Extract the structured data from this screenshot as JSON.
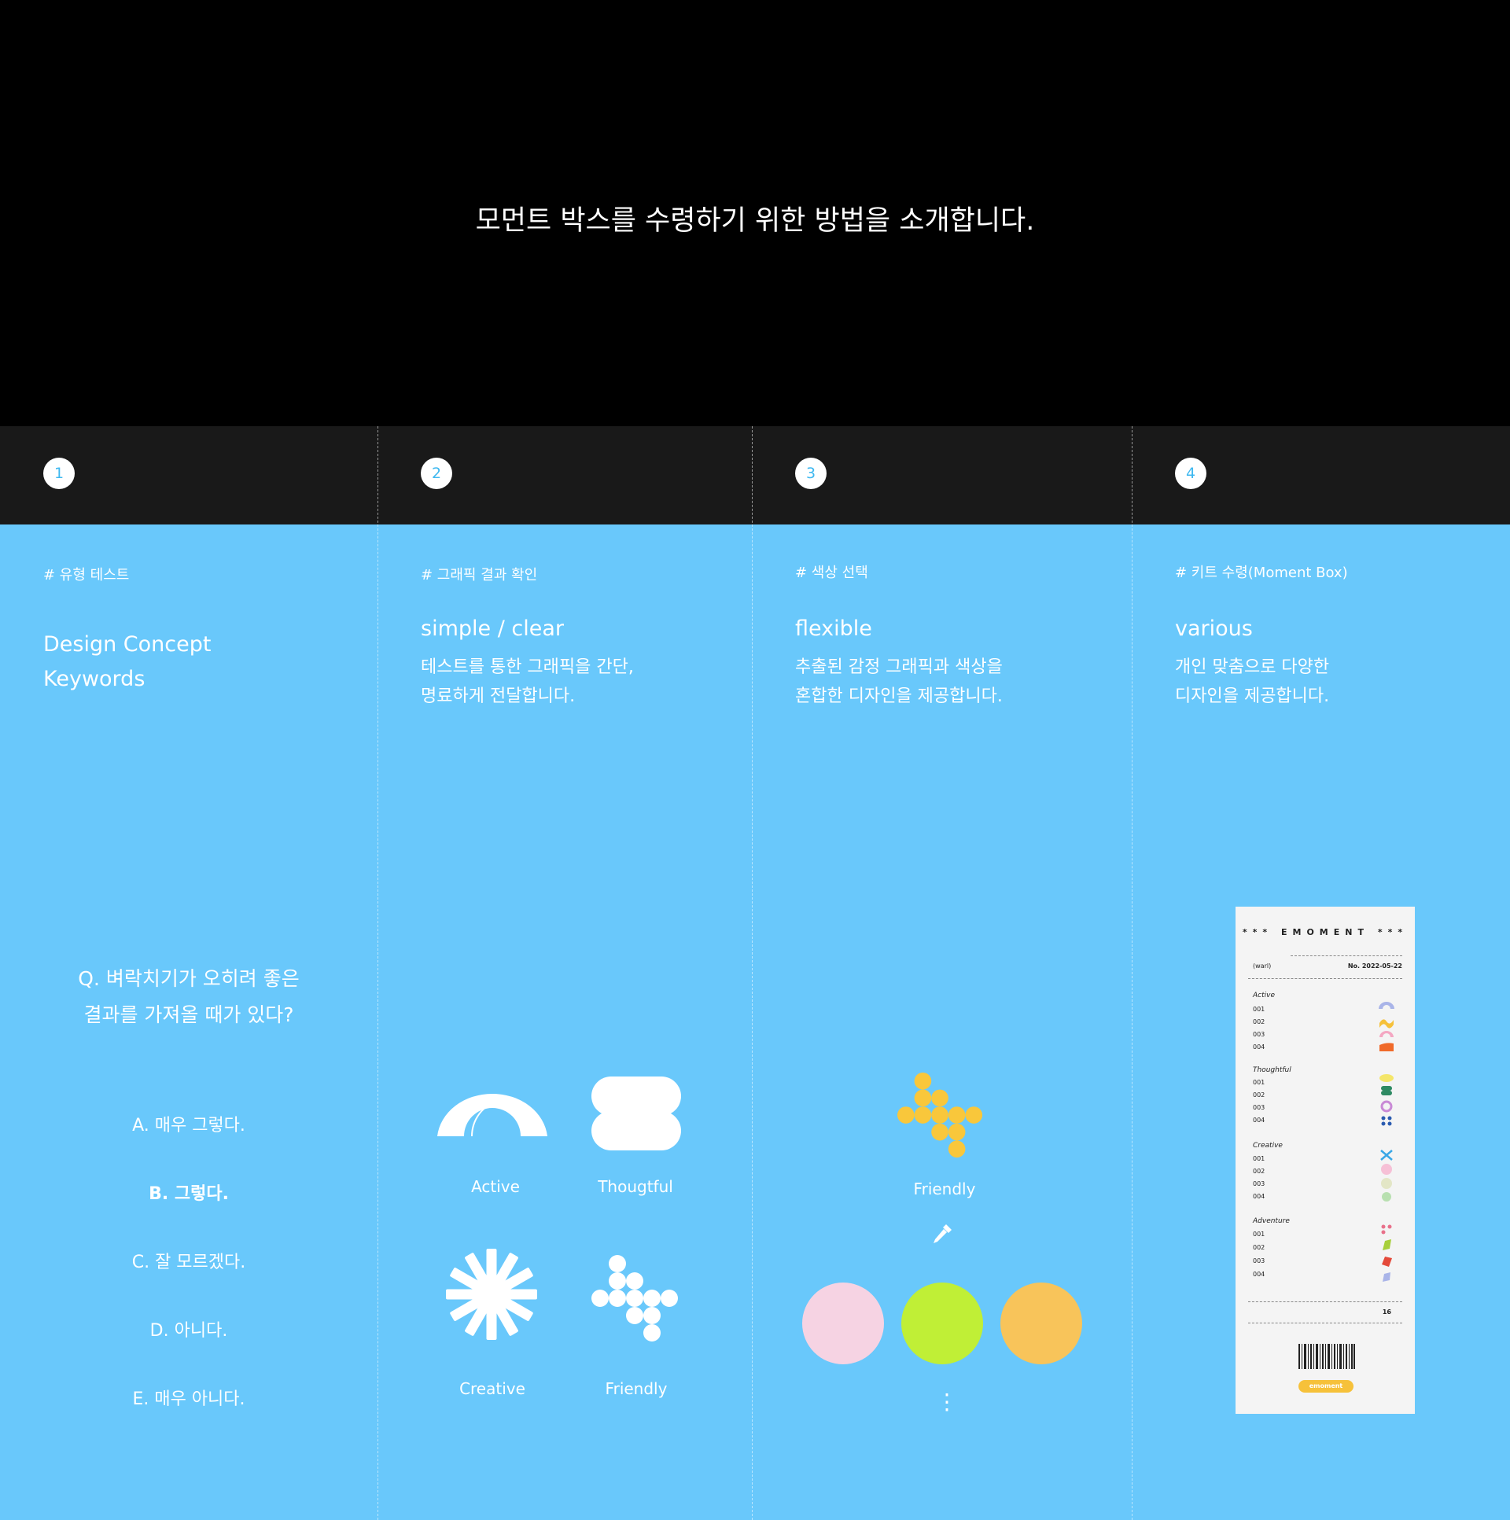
{
  "hero": {
    "title": "모먼트 박스를 수령하기 위한 방법을 소개합니다."
  },
  "steps": [
    {
      "num": "1",
      "hashtag": "# 유형 테스트",
      "keyword": "Design Concept Keywords",
      "keyword_line1": "Design Concept",
      "keyword_line2": "Keywords"
    },
    {
      "num": "2",
      "hashtag": "# 그래픽 결과 확인",
      "keyword": "simple / clear",
      "desc_line1": "테스트를 통한 그래픽을 간단,",
      "desc_line2": "명료하게 전달합니다."
    },
    {
      "num": "3",
      "hashtag": "# 색상 선택",
      "keyword": "flexible",
      "desc_line1": "추출된 감정 그래픽과 색상을",
      "desc_line2": "혼합한 디자인을 제공합니다."
    },
    {
      "num": "4",
      "hashtag": "# 키트 수령(Moment Box)",
      "keyword": "various",
      "desc_line1": "개인 맞춤으로 다양한",
      "desc_line2": "디자인을 제공합니다."
    }
  ],
  "question": {
    "line1": "Q. 벼락치기가 오히려 좋은",
    "line2": "결과를 가져올 때가 있다?",
    "options": [
      "A. 매우 그렇다.",
      "B. 그렇다.",
      "C. 잘 모르겠다.",
      "D. 아니다.",
      "E. 매우 아니다."
    ],
    "selected": "B. 그렇다."
  },
  "graphics": [
    {
      "label": "Active",
      "icon": "arch-icon"
    },
    {
      "label": "Thougtful",
      "icon": "double-pill-icon"
    },
    {
      "label": "Creative",
      "icon": "starburst-icon"
    },
    {
      "label": "Friendly",
      "icon": "dot-cluster-icon"
    }
  ],
  "color_select": {
    "graphic_label": "Friendly",
    "graphic_color": "#f9c73b",
    "tool_icon": "eyedropper-icon",
    "swatches": [
      "#f6d3e3",
      "#c0ef36",
      "#f8c45a"
    ],
    "more": "⋮"
  },
  "colors": {
    "background_blue": "#69c8fb",
    "number_accent": "#3eb8f0",
    "hero_bg": "#000000",
    "bar_bg": "#191919"
  },
  "receipt": {
    "title_left": "***",
    "title": "EMOMENT",
    "title_right": "***",
    "user": "(warl)",
    "number": "No. 2022-05-22",
    "sections": [
      {
        "name": "Active",
        "rows": [
          "001",
          "002",
          "003",
          "004"
        ]
      },
      {
        "name": "Thoughtful",
        "rows": [
          "001",
          "002",
          "003",
          "004"
        ]
      },
      {
        "name": "Creative",
        "rows": [
          "001",
          "002",
          "003",
          "004"
        ]
      },
      {
        "name": "Adventure",
        "rows": [
          "001",
          "002",
          "003",
          "004"
        ]
      }
    ],
    "total": "16",
    "logo": "emoment"
  }
}
